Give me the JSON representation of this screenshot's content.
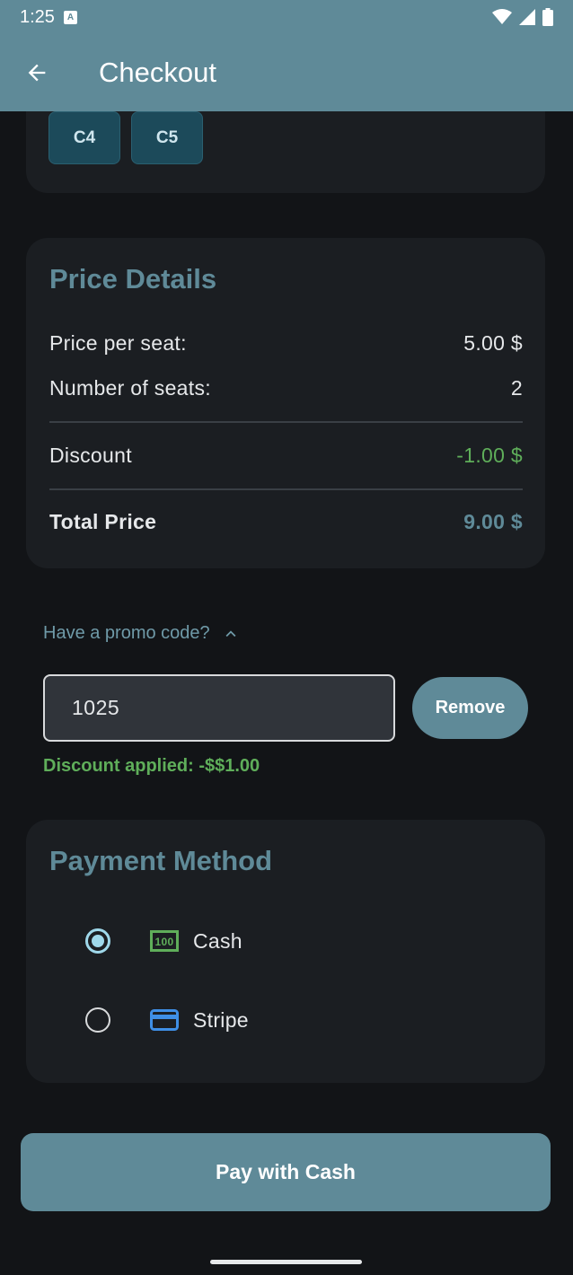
{
  "status": {
    "time": "1:25"
  },
  "appbar": {
    "title": "Checkout"
  },
  "seats": [
    "C4",
    "C5"
  ],
  "price": {
    "title": "Price Details",
    "per_seat_label": "Price per seat:",
    "per_seat_value": "5.00 $",
    "num_seats_label": "Number of seats:",
    "num_seats_value": "2",
    "discount_label": "Discount",
    "discount_value": "-1.00 $",
    "total_label": "Total Price",
    "total_value": "9.00 $"
  },
  "promo": {
    "toggle_label": "Have a promo code?",
    "code_value": "1025",
    "remove_label": "Remove",
    "discount_msg": "Discount applied: -$$1.00"
  },
  "payment": {
    "title": "Payment Method",
    "options": [
      {
        "label": "Cash",
        "selected": true,
        "icon": "cash-icon"
      },
      {
        "label": "Stripe",
        "selected": false,
        "icon": "credit-card-icon"
      }
    ]
  },
  "pay_button_label": "Pay with Cash",
  "colors": {
    "accent": "#5f8a98",
    "background": "#121417",
    "card": "#1b1e22",
    "success": "#5fae5a"
  }
}
